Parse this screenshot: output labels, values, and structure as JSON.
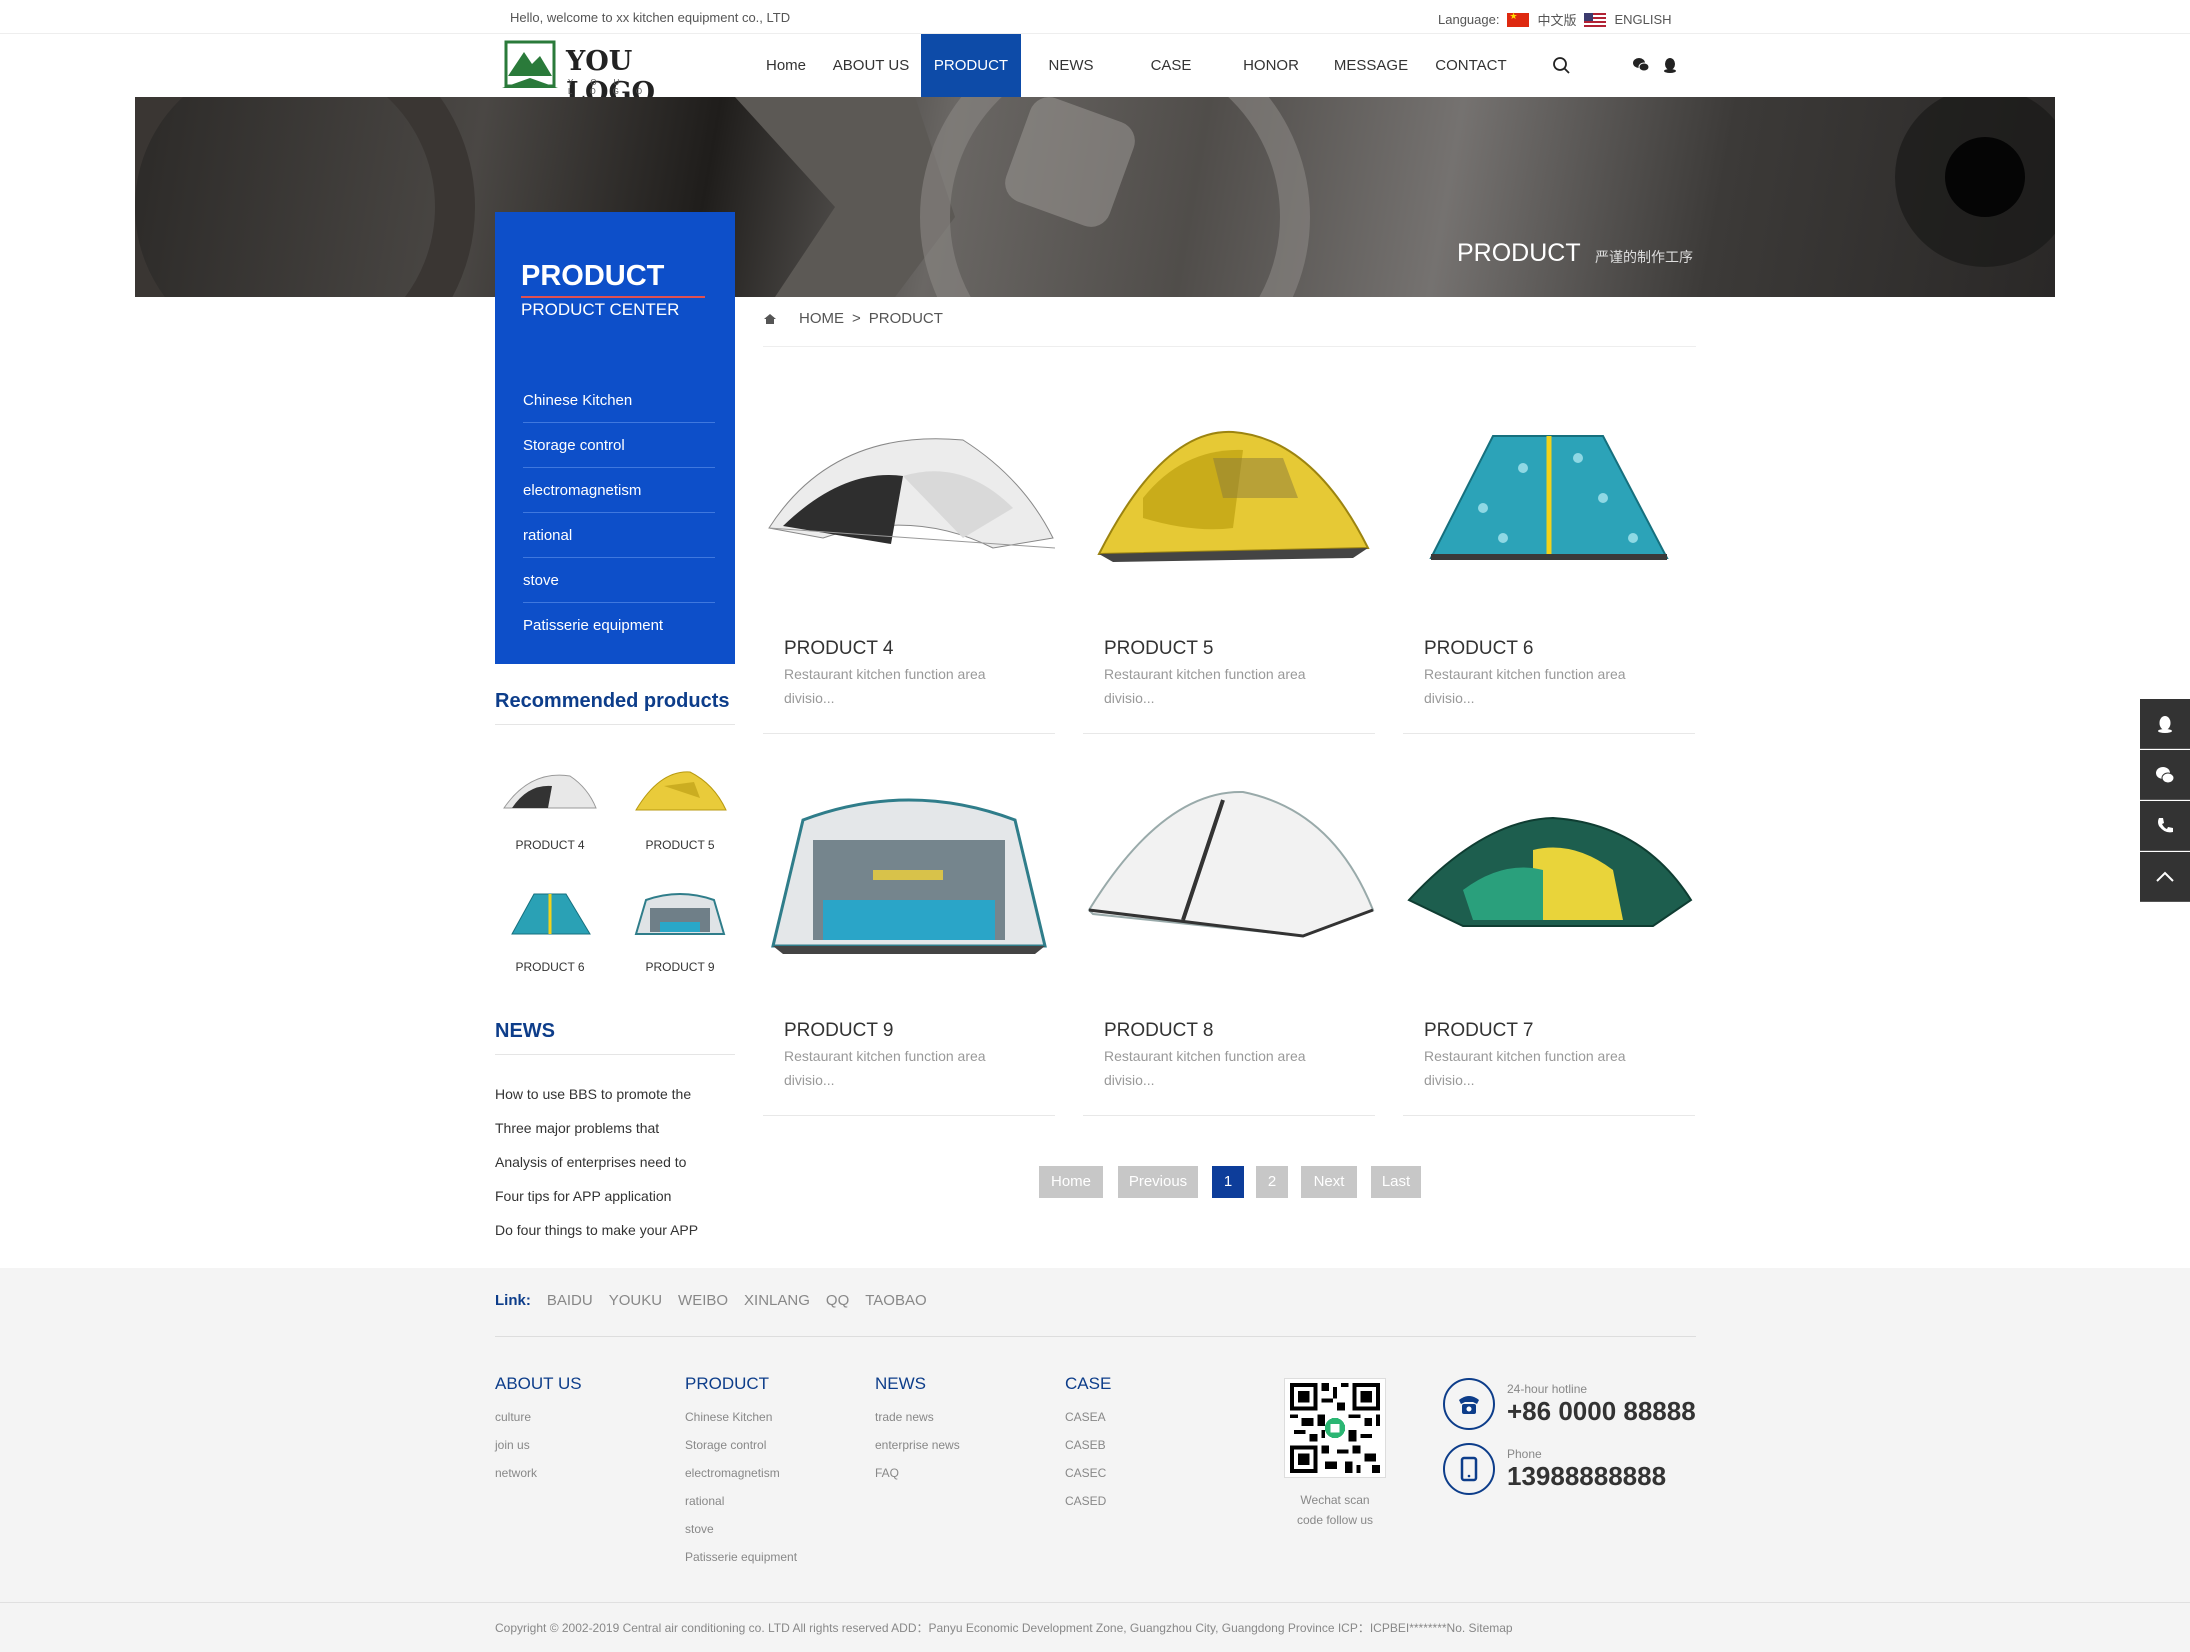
{
  "topbar": {
    "welcome": "Hello, welcome to xx kitchen equipment co., LTD",
    "language_label": "Language:",
    "lang_cn": "中文版",
    "lang_en": "ENGLISH"
  },
  "logo": {
    "main": "YOU LOGO",
    "sub": "YOU LOGO"
  },
  "nav": {
    "items": [
      "Home",
      "ABOUT US",
      "PRODUCT",
      "NEWS",
      "CASE",
      "HONOR",
      "MESSAGE",
      "CONTACT"
    ],
    "active": "PRODUCT"
  },
  "banner": {
    "title": "PRODUCT",
    "subtitle": "严谨的制作工序"
  },
  "sidebar": {
    "heading": "PRODUCT",
    "subheading": "PRODUCT CENTER",
    "menu": [
      "Chinese Kitchen",
      "Storage control",
      "electromagnetism",
      "rational",
      "stove",
      "Patisserie equipment"
    ],
    "recommended_title": "Recommended products",
    "recommended": [
      "PRODUCT 4",
      "PRODUCT 5",
      "PRODUCT 6",
      "PRODUCT 9"
    ],
    "news_title": "NEWS",
    "news": [
      "How to use BBS to promote the",
      "Three major problems that",
      "Analysis of enterprises need to",
      "Four tips for APP application",
      "Do four things to make your APP"
    ]
  },
  "breadcrumb": {
    "home": "HOME",
    "sep": ">",
    "current": "PRODUCT"
  },
  "products": [
    {
      "name": "PRODUCT 4",
      "desc": "Restaurant kitchen function area divisio..."
    },
    {
      "name": "PRODUCT 5",
      "desc": "Restaurant kitchen function area divisio..."
    },
    {
      "name": "PRODUCT 6",
      "desc": "Restaurant kitchen function area divisio..."
    },
    {
      "name": "PRODUCT 9",
      "desc": "Restaurant kitchen function area divisio..."
    },
    {
      "name": "PRODUCT 8",
      "desc": "Restaurant kitchen function area divisio..."
    },
    {
      "name": "PRODUCT 7",
      "desc": "Restaurant kitchen function area divisio..."
    }
  ],
  "pagination": {
    "home": "Home",
    "prev": "Previous",
    "p1": "1",
    "p2": "2",
    "next": "Next",
    "last": "Last"
  },
  "footer": {
    "link_label": "Link:",
    "links": [
      "BAIDU",
      "YOUKU",
      "WEIBO",
      "XINLANG",
      "QQ",
      "TAOBAO"
    ],
    "about": {
      "title": "ABOUT US",
      "items": [
        "culture",
        "join us",
        "network"
      ]
    },
    "product": {
      "title": "PRODUCT",
      "items": [
        "Chinese Kitchen",
        "Storage control",
        "electromagnetism",
        "rational",
        "stove",
        "Patisserie equipment"
      ]
    },
    "news": {
      "title": "NEWS",
      "items": [
        "trade news",
        "enterprise news",
        "FAQ"
      ]
    },
    "case": {
      "title": "CASE",
      "items": [
        "CASEA",
        "CASEB",
        "CASEC",
        "CASED"
      ]
    },
    "qr_caption_1": "Wechat scan",
    "qr_caption_2": "code follow us",
    "hotline_label": "24-hour hotline",
    "hotline": "+86 0000 88888",
    "phone_label": "Phone",
    "phone": "13988888888",
    "copyright": "Copyright © 2002-2019 Central air conditioning co. LTD All rights reserved    ADD：Panyu Economic Development Zone, Guangzhou City, Guangdong Province    ICP：ICPBEI********No.    Sitemap"
  },
  "colors": {
    "brand": "#0d4ba8",
    "sidebar": "#0d4fc9",
    "heading": "#0d3d8a",
    "footer_bg": "#f4f4f4"
  }
}
